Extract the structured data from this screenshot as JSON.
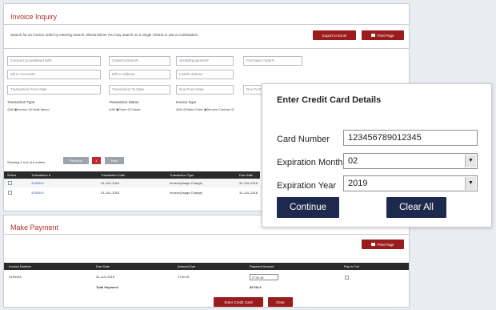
{
  "inquiry": {
    "title": "Invoice Inquiry",
    "description": "Search for an invoice order by entering search criteria below You may search on a single criteria or use a combination",
    "export_label": "Export to Excel",
    "print_label": "Print Page",
    "fields": [
      "Invoice/Consolidated Bill#",
      "Order/Contract#",
      "Serial/Equipment#",
      "Purchase Order#",
      "Bill to Account#",
      "Bill to Address",
      "Install Address",
      "Transaction From Date",
      "Transaction To Date",
      "Due From Date",
      "Due To Date"
    ],
    "filters": {
      "transaction_type_label": "Transaction Type",
      "transaction_type_options": "◎All ◉Invoice ◎Credit Memo",
      "transaction_status_label": "Transaction Status",
      "transaction_status_options": "◎All ◉Open ◎Closed",
      "invoice_type_label": "Invoice Type",
      "invoice_type_options": "◎All ◎Sales Order ◉Service Contract ◎"
    },
    "showing": "Showing 1 to 6 of 6 entries",
    "pagination": {
      "previous": "Previous",
      "page": "1",
      "next": "Next"
    },
    "columns": [
      "Select",
      "Transaction #",
      "Transaction Date",
      "Transaction Type",
      "Due Date"
    ],
    "rows": [
      {
        "transaction": "4195342",
        "date": "01-JUL-2016",
        "type": "Invoice(Usage Charge)",
        "due": "31-JUL-2016"
      },
      {
        "transaction": "4195343",
        "date": "01-JUL-2016",
        "type": "Invoice(Usage Charge)",
        "due": "31-JUL-2016"
      }
    ]
  },
  "payment": {
    "title": "Make Payment",
    "print_label": "Print Page",
    "columns": [
      "Invoice Number",
      "Due Date",
      "Amount Due",
      "Payment Amount",
      "Pay in Full"
    ],
    "row": {
      "invoice": "4195154",
      "due": "31-JUL-2016",
      "amount_due": "2740.45",
      "payment_amount": "2740.45"
    },
    "total_label": "Total Payment:",
    "total_value": "$2740.4",
    "enter_card_label": "Enter Credit Card",
    "clear_label": "Clear"
  },
  "card_modal": {
    "title": "Enter Credit Card Details",
    "card_number_label": "Card Number",
    "card_number_value": "123456789012345",
    "exp_month_label": "Expiration Month",
    "exp_month_value": "02",
    "exp_year_label": "Expiration Year",
    "exp_year_value": "2019",
    "continue_label": "Continue",
    "clear_all_label": "Clear All"
  },
  "colors": {
    "brand_red": "#9b1c1c",
    "title_red": "#b0312f",
    "modal_button": "#1d2a4d",
    "table_header": "#2a2a2a"
  }
}
